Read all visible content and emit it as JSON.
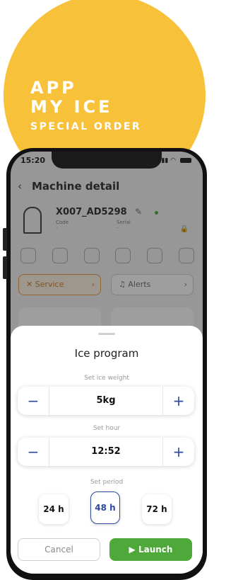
{
  "promo": {
    "line1": "APP",
    "line2": "MY ICE",
    "line3": "SPECIAL ORDER"
  },
  "status": {
    "time": "15:20"
  },
  "app": {
    "title": "Machine detail",
    "machine_name": "X007_AD5298",
    "code_label": "Code",
    "code_value": "-",
    "serial_label": "Serial",
    "serial_value": "-",
    "service_label": "Service",
    "alerts_label": "Alerts"
  },
  "sheet": {
    "title": "Ice program",
    "weight_label": "Set ice weight",
    "weight_value": "5kg",
    "hour_label": "Set hour",
    "hour_value": "12:52",
    "period_label": "Set period",
    "periods": [
      "24 h",
      "48 h",
      "72 h"
    ],
    "selected_period": "48 h",
    "cancel": "Cancel",
    "launch": "Launch"
  },
  "colors": {
    "accent": "#2d4a9b",
    "launch": "#4fa83a",
    "promo": "#F7C23A",
    "service": "#e49a3a"
  }
}
